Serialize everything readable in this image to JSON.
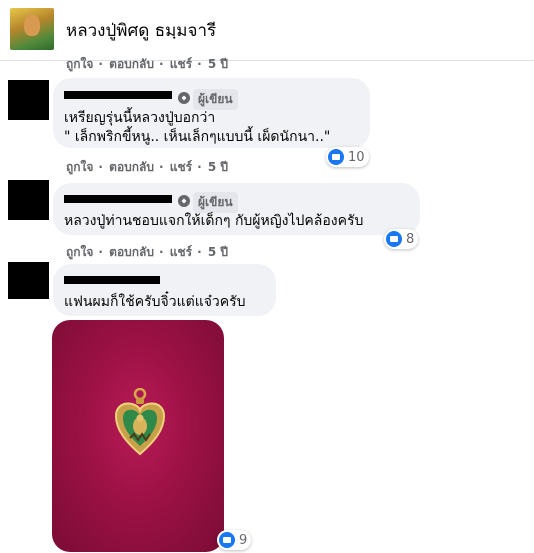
{
  "header": {
    "page_name": "หลวงปู่พิศดู ธมฺมจารี"
  },
  "top_actions": {
    "like": "ถูกใจ",
    "reply": "ตอบกลับ",
    "share": "แชร์",
    "time": "5 ปี"
  },
  "comments": [
    {
      "badge": "ผู้เขียน",
      "text_line1": "เหรียญรุ่นนี้หลวงปู่บอกว่า",
      "text_line2": "\" เล็กพริกขี้หนู.. เห็นเล็กๆแบบนี้ เผ็ดนักนา..\"",
      "reactions": "10",
      "actions": {
        "like": "ถูกใจ",
        "reply": "ตอบกลับ",
        "share": "แชร์",
        "time": "5 ปี"
      }
    },
    {
      "badge": "ผู้เขียน",
      "text_line1": "หลวงปู่ท่านชอบแจกให้เด็กๆ กับผู้หญิงไปคล้องครับ",
      "reactions": "8",
      "actions": {
        "like": "ถูกใจ",
        "reply": "ตอบกลับ",
        "share": "แชร์",
        "time": "5 ปี"
      }
    },
    {
      "text_line1": "แฟนผมก็ใช้ครับจิ๋วแต่แจ๋วครับ",
      "reactions": "9"
    }
  ],
  "colors": {
    "like_blue": "#1877f2",
    "bubble_bg": "#f0f2f5",
    "meta_gray": "#65676b"
  }
}
